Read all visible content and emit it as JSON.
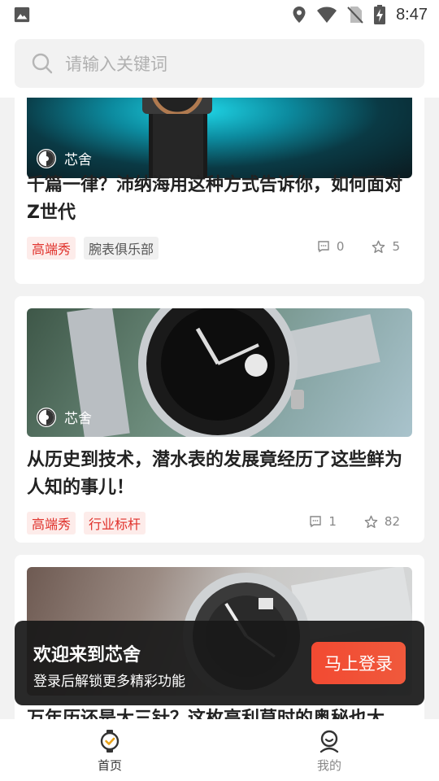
{
  "status_bar": {
    "time": "8:47"
  },
  "search": {
    "placeholder": "请输入关键词"
  },
  "feed": {
    "cards": [
      {
        "source": "芯舍",
        "title": "千篇一律？沛纳海用这种方式告诉你，如何面对Z世代",
        "tags": [
          "高端秀",
          "腕表俱乐部"
        ],
        "comments": "0",
        "favorites": "5"
      },
      {
        "source": "芯舍",
        "title": "从历史到技术，潜水表的发展竟经历了这些鲜为人知的事儿！",
        "tags": [
          "高端秀",
          "行业标杆"
        ],
        "comments": "1",
        "favorites": "82"
      },
      {
        "title": "万年历还是大三针？这枚高利莫时的奥秘也大"
      }
    ]
  },
  "login_banner": {
    "title": "欢迎来到芯舍",
    "subtitle": "登录后解锁更多精彩功能",
    "button": "马上登录"
  },
  "tab_bar": {
    "home": "首页",
    "mine": "我的"
  },
  "colors": {
    "accent": "#e0302a",
    "tag_bg": "#fdecea"
  }
}
